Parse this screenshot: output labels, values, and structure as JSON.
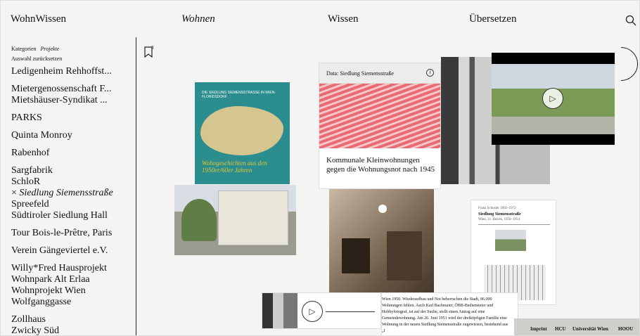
{
  "header": {
    "brand": "WohnWissen",
    "nav": [
      "Wohnen",
      "Wissen",
      "Übersetzen"
    ]
  },
  "sidebar": {
    "filter_label": "Kategorien",
    "filter_value": "Projekte",
    "reset_label": "Auswahl zurücksetzen",
    "items": [
      "Ledigenheim Rehhoffst...",
      "Mietergenossenschaft F...",
      "Mietshäuser-Syndikat ...",
      "PARKS",
      "Quinta Monroy",
      "Rabenhof",
      "Sargfabrik",
      "SchloR",
      "Siedlung Siemensstraße",
      "Spreefeld",
      "Südtiroler Siedlung Hall",
      "Tour Bois-le-Prêtre, Paris",
      "Verein Gängeviertel e.V.",
      "Willy*Fred Hausprojekt",
      "Wohnpark Alt Erlaa",
      "Wohnprojekt Wien",
      "Wolfganggasse",
      "Zollhaus",
      "Zwicky Süd"
    ],
    "selected_marker": "×"
  },
  "bookmarks": {
    "count": "3"
  },
  "cards": {
    "book": {
      "top_text": "DIE SIEDLUNG SIEMENSSTRASSE IN WIEN-FLORIDSDORF",
      "title": "Wohngeschichten aus den 1950er/60er Jahren"
    },
    "data_card": {
      "label": "Data: Siedlung Siemensstraße",
      "info": "i",
      "title": "Kommunale Kleinwohnungen gegen die Wohnungsnot nach 1945"
    },
    "document": {
      "line1": "Franz Schuster 1892–1972",
      "line2": "Siedlung Siemensstraße",
      "line3": "Wien, 21. Bezirk, 1950–1954"
    },
    "text_excerpt": "Wien 1950. Wiederaufbau und Not beherrschen die Stadt, 86.000 Wohnungen fehlen. Auch Karl Bachmaier, ÖBB-Bediensteter und Hobbyfotograf, ist auf der Suche, stellt einen Antrag auf eine Gemeindewohnung. Am 26. Juni 1951 wird der dreiköpfigen Familie eine Wohnung in der neuen Siedlung Siemensstraße zugewiesen, bestehend aus „I"
  },
  "footer": [
    "Imprint",
    "HCU",
    "Universität Wien",
    "HOOU"
  ],
  "colors": {
    "accent_teal": "#2b8d8d",
    "accent_red": "#e96a72",
    "sidebar_rule": "#222222"
  }
}
